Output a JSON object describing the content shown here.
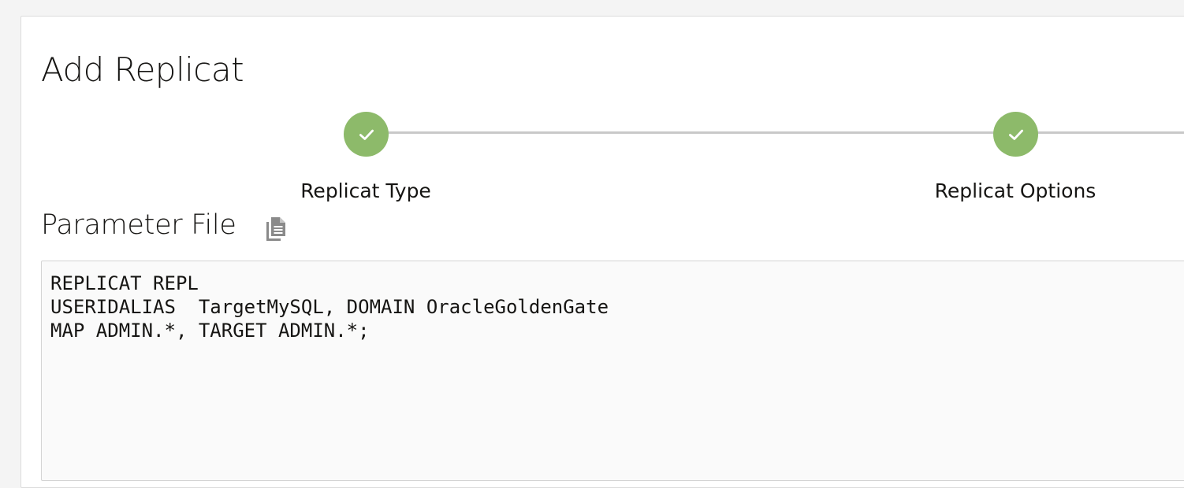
{
  "page": {
    "title": "Add Replicat"
  },
  "train": {
    "steps": [
      {
        "label": "Replicat Type",
        "status": "complete",
        "icon": "checkmark-icon"
      },
      {
        "label": "Replicat Options",
        "status": "complete",
        "icon": "checkmark-icon"
      }
    ],
    "complete_color": "#8dba6a"
  },
  "parameter_file": {
    "title": "Parameter File",
    "copy_icon": "copy-document-icon",
    "content": "REPLICAT REPL\nUSERIDALIAS  TargetMySQL, DOMAIN OracleGoldenGate\nMAP ADMIN.*, TARGET ADMIN.*;"
  }
}
